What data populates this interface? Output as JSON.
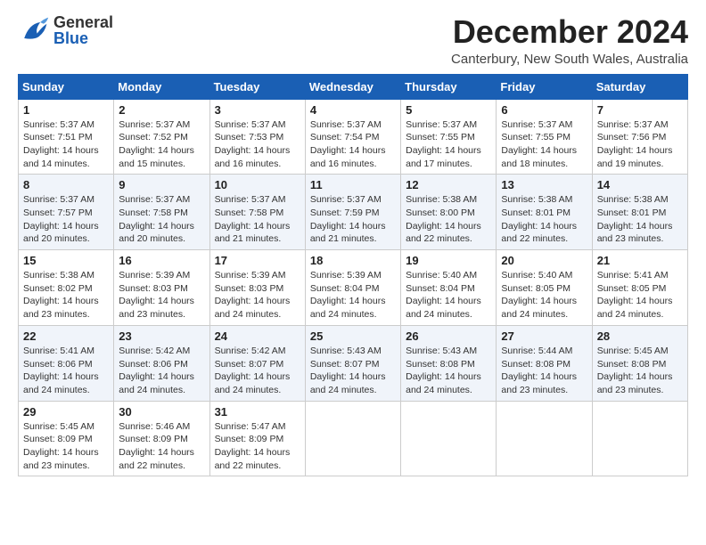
{
  "header": {
    "logo_general": "General",
    "logo_blue": "Blue",
    "month_title": "December 2024",
    "location": "Canterbury, New South Wales, Australia"
  },
  "days_of_week": [
    "Sunday",
    "Monday",
    "Tuesday",
    "Wednesday",
    "Thursday",
    "Friday",
    "Saturday"
  ],
  "weeks": [
    [
      {
        "day": "1",
        "sunrise": "Sunrise: 5:37 AM",
        "sunset": "Sunset: 7:51 PM",
        "daylight": "Daylight: 14 hours and 14 minutes."
      },
      {
        "day": "2",
        "sunrise": "Sunrise: 5:37 AM",
        "sunset": "Sunset: 7:52 PM",
        "daylight": "Daylight: 14 hours and 15 minutes."
      },
      {
        "day": "3",
        "sunrise": "Sunrise: 5:37 AM",
        "sunset": "Sunset: 7:53 PM",
        "daylight": "Daylight: 14 hours and 16 minutes."
      },
      {
        "day": "4",
        "sunrise": "Sunrise: 5:37 AM",
        "sunset": "Sunset: 7:54 PM",
        "daylight": "Daylight: 14 hours and 16 minutes."
      },
      {
        "day": "5",
        "sunrise": "Sunrise: 5:37 AM",
        "sunset": "Sunset: 7:55 PM",
        "daylight": "Daylight: 14 hours and 17 minutes."
      },
      {
        "day": "6",
        "sunrise": "Sunrise: 5:37 AM",
        "sunset": "Sunset: 7:55 PM",
        "daylight": "Daylight: 14 hours and 18 minutes."
      },
      {
        "day": "7",
        "sunrise": "Sunrise: 5:37 AM",
        "sunset": "Sunset: 7:56 PM",
        "daylight": "Daylight: 14 hours and 19 minutes."
      }
    ],
    [
      {
        "day": "8",
        "sunrise": "Sunrise: 5:37 AM",
        "sunset": "Sunset: 7:57 PM",
        "daylight": "Daylight: 14 hours and 20 minutes."
      },
      {
        "day": "9",
        "sunrise": "Sunrise: 5:37 AM",
        "sunset": "Sunset: 7:58 PM",
        "daylight": "Daylight: 14 hours and 20 minutes."
      },
      {
        "day": "10",
        "sunrise": "Sunrise: 5:37 AM",
        "sunset": "Sunset: 7:58 PM",
        "daylight": "Daylight: 14 hours and 21 minutes."
      },
      {
        "day": "11",
        "sunrise": "Sunrise: 5:37 AM",
        "sunset": "Sunset: 7:59 PM",
        "daylight": "Daylight: 14 hours and 21 minutes."
      },
      {
        "day": "12",
        "sunrise": "Sunrise: 5:38 AM",
        "sunset": "Sunset: 8:00 PM",
        "daylight": "Daylight: 14 hours and 22 minutes."
      },
      {
        "day": "13",
        "sunrise": "Sunrise: 5:38 AM",
        "sunset": "Sunset: 8:01 PM",
        "daylight": "Daylight: 14 hours and 22 minutes."
      },
      {
        "day": "14",
        "sunrise": "Sunrise: 5:38 AM",
        "sunset": "Sunset: 8:01 PM",
        "daylight": "Daylight: 14 hours and 23 minutes."
      }
    ],
    [
      {
        "day": "15",
        "sunrise": "Sunrise: 5:38 AM",
        "sunset": "Sunset: 8:02 PM",
        "daylight": "Daylight: 14 hours and 23 minutes."
      },
      {
        "day": "16",
        "sunrise": "Sunrise: 5:39 AM",
        "sunset": "Sunset: 8:03 PM",
        "daylight": "Daylight: 14 hours and 23 minutes."
      },
      {
        "day": "17",
        "sunrise": "Sunrise: 5:39 AM",
        "sunset": "Sunset: 8:03 PM",
        "daylight": "Daylight: 14 hours and 24 minutes."
      },
      {
        "day": "18",
        "sunrise": "Sunrise: 5:39 AM",
        "sunset": "Sunset: 8:04 PM",
        "daylight": "Daylight: 14 hours and 24 minutes."
      },
      {
        "day": "19",
        "sunrise": "Sunrise: 5:40 AM",
        "sunset": "Sunset: 8:04 PM",
        "daylight": "Daylight: 14 hours and 24 minutes."
      },
      {
        "day": "20",
        "sunrise": "Sunrise: 5:40 AM",
        "sunset": "Sunset: 8:05 PM",
        "daylight": "Daylight: 14 hours and 24 minutes."
      },
      {
        "day": "21",
        "sunrise": "Sunrise: 5:41 AM",
        "sunset": "Sunset: 8:05 PM",
        "daylight": "Daylight: 14 hours and 24 minutes."
      }
    ],
    [
      {
        "day": "22",
        "sunrise": "Sunrise: 5:41 AM",
        "sunset": "Sunset: 8:06 PM",
        "daylight": "Daylight: 14 hours and 24 minutes."
      },
      {
        "day": "23",
        "sunrise": "Sunrise: 5:42 AM",
        "sunset": "Sunset: 8:06 PM",
        "daylight": "Daylight: 14 hours and 24 minutes."
      },
      {
        "day": "24",
        "sunrise": "Sunrise: 5:42 AM",
        "sunset": "Sunset: 8:07 PM",
        "daylight": "Daylight: 14 hours and 24 minutes."
      },
      {
        "day": "25",
        "sunrise": "Sunrise: 5:43 AM",
        "sunset": "Sunset: 8:07 PM",
        "daylight": "Daylight: 14 hours and 24 minutes."
      },
      {
        "day": "26",
        "sunrise": "Sunrise: 5:43 AM",
        "sunset": "Sunset: 8:08 PM",
        "daylight": "Daylight: 14 hours and 24 minutes."
      },
      {
        "day": "27",
        "sunrise": "Sunrise: 5:44 AM",
        "sunset": "Sunset: 8:08 PM",
        "daylight": "Daylight: 14 hours and 23 minutes."
      },
      {
        "day": "28",
        "sunrise": "Sunrise: 5:45 AM",
        "sunset": "Sunset: 8:08 PM",
        "daylight": "Daylight: 14 hours and 23 minutes."
      }
    ],
    [
      {
        "day": "29",
        "sunrise": "Sunrise: 5:45 AM",
        "sunset": "Sunset: 8:09 PM",
        "daylight": "Daylight: 14 hours and 23 minutes."
      },
      {
        "day": "30",
        "sunrise": "Sunrise: 5:46 AM",
        "sunset": "Sunset: 8:09 PM",
        "daylight": "Daylight: 14 hours and 22 minutes."
      },
      {
        "day": "31",
        "sunrise": "Sunrise: 5:47 AM",
        "sunset": "Sunset: 8:09 PM",
        "daylight": "Daylight: 14 hours and 22 minutes."
      },
      null,
      null,
      null,
      null
    ]
  ]
}
